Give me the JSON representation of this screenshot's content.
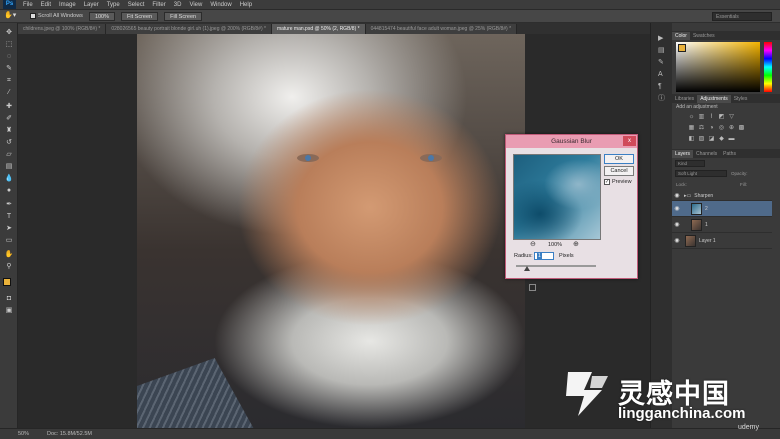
{
  "app": {
    "logo": "Ps"
  },
  "menu": [
    "File",
    "Edit",
    "Image",
    "Layer",
    "Type",
    "Select",
    "Filter",
    "3D",
    "View",
    "Window",
    "Help"
  ],
  "options": {
    "tool_icon": "hand-icon",
    "scroll_all_label": "Scroll All Windows",
    "btn_100": "100%",
    "btn_fit": "Fit Screen",
    "btn_fill": "Fill Screen",
    "workspace": "Essentials"
  },
  "tabs": [
    {
      "label": "childrens.jpeg @ 100% (RGB/8#) *",
      "active": false
    },
    {
      "label": "028026565 beauty portrait blonde girl.uh (1).jpeg @ 200% (RGB/8#) *",
      "active": false
    },
    {
      "label": "mature man.psd @ 50% (2, RGB/8) *",
      "active": true
    },
    {
      "label": "044815474 beautiful face adult woman.jpeg @ 25% (RGB/8#) *",
      "active": false
    }
  ],
  "status": {
    "zoom": "50%",
    "doc": "Doc: 15.8M/52.5M"
  },
  "panels": {
    "color_tabs": [
      "Color",
      "Swatches"
    ],
    "adjust_tabs": [
      "Libraries",
      "Adjustments",
      "Styles"
    ],
    "add_adjustment": "Add an adjustment",
    "layers_tabs": [
      "Layers",
      "Channels",
      "Paths"
    ],
    "kind_label": "Kind",
    "blend_mode": "Soft Light",
    "opacity_label": "Opacity:",
    "lock_label": "Lock:",
    "fill_label": "Fill:",
    "layers": [
      {
        "name": "Sharpen",
        "type": "group",
        "selected": false
      },
      {
        "name": "2",
        "type": "layer",
        "selected": true
      },
      {
        "name": "1",
        "type": "layer",
        "selected": false
      },
      {
        "name": "Layer 1",
        "type": "layer",
        "selected": false
      }
    ]
  },
  "dialog": {
    "title": "Gaussian Blur",
    "close": "x",
    "ok": "OK",
    "cancel": "Cancel",
    "preview_label": "Preview",
    "preview_checked": "✓",
    "zoom": "100%",
    "radius_label": "Radius:",
    "radius_value": "1",
    "pixels": "Pixels"
  },
  "watermark": {
    "cn": "灵感中国",
    "url": "lingganchina.com",
    "udemy": "udemy"
  },
  "colors": {
    "accent": "#e99cb2",
    "selection": "#4f6a8a",
    "foreground": "#eab23a"
  }
}
